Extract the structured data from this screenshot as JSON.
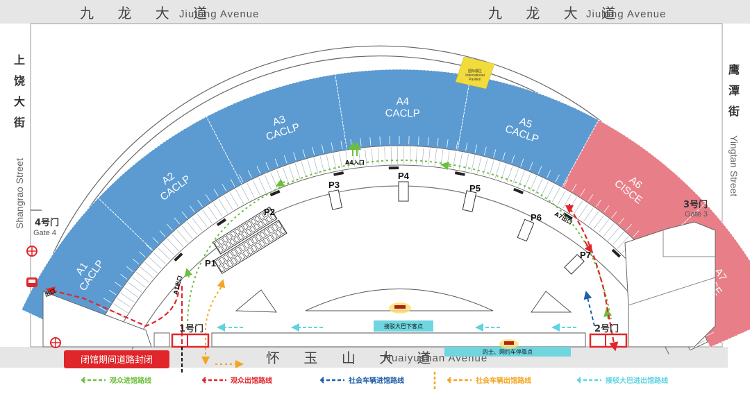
{
  "roads": {
    "top_cn": "九 龙 大 道",
    "top_en": "Jiulong Avenue",
    "bottom_cn": "怀 玉 山 大 道",
    "bottom_en": "Huaiyushan Avenue",
    "left_cn": [
      "上",
      "饶",
      "大",
      "街"
    ],
    "left_en": "Shangrao Street",
    "right_cn": [
      "鹰",
      "潭",
      "街"
    ],
    "right_en": "Yingtan Street"
  },
  "halls": [
    {
      "id": "A1",
      "name": "CACLP",
      "color": "#5b9bd1"
    },
    {
      "id": "A2",
      "name": "CACLP",
      "color": "#5b9bd1"
    },
    {
      "id": "A3",
      "name": "CACLP",
      "color": "#5b9bd1"
    },
    {
      "id": "A4",
      "name": "CACLP",
      "color": "#5b9bd1"
    },
    {
      "id": "A5",
      "name": "CACLP",
      "color": "#5b9bd1"
    },
    {
      "id": "A6",
      "name": "CISCE",
      "color": "#e87f88"
    },
    {
      "id": "A7",
      "name": "CISCE",
      "color": "#e87f88"
    }
  ],
  "international": {
    "cn": "国际展区",
    "en1": "International",
    "en2": "Pavilion",
    "color": "#f2dc3c"
  },
  "parking": [
    "P1",
    "P2",
    "P3",
    "P4",
    "P5",
    "P6",
    "P7"
  ],
  "entrances": {
    "a1": "A1出口",
    "a4": "A4入口",
    "a7": "A7出口",
    "left_exit": "出口"
  },
  "gates": {
    "gate1": "1号门",
    "gate2": "2号门",
    "gate3_cn": "3号门",
    "gate3_en": "Gate 3",
    "gate4_cn": "4号门",
    "gate4_en": "Gate 4"
  },
  "labels": {
    "shuttle_drop": "接驳大巴下客点",
    "taxi_stop": "的士、网约车停靠点",
    "closed": "闭馆期间道路封闭"
  },
  "legend": [
    {
      "text": "观众进馆路线",
      "color": "#6cbf3c"
    },
    {
      "text": "观众出馆路线",
      "color": "#e0262b"
    },
    {
      "text": "社会车辆进馆路线",
      "color": "#1f5fa8"
    },
    {
      "text": "社会车辆出馆路线",
      "color": "#f2a51f"
    },
    {
      "text": "接驳大巴进出馆路线",
      "color": "#5fd4e0"
    }
  ]
}
